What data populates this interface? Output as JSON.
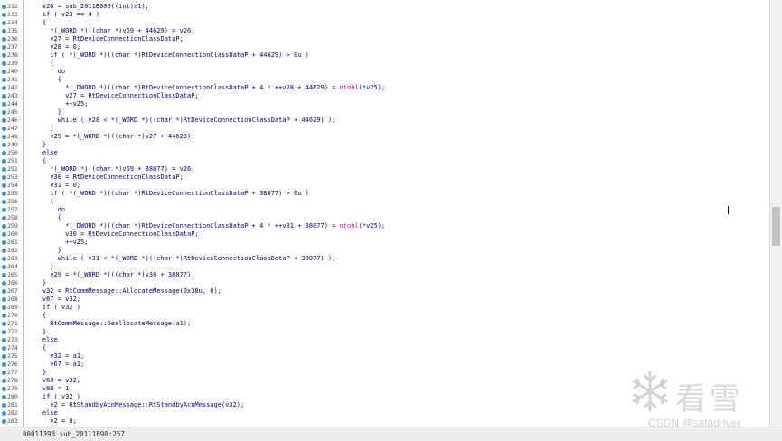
{
  "lines": [
    {
      "num": "232",
      "code": "    v26 = sub_2011E000((int)a1);"
    },
    {
      "num": "233",
      "code": "    if ( v23 == 4 )"
    },
    {
      "num": "234",
      "code": "    {"
    },
    {
      "num": "235",
      "code": "      *(_WORD *)((char *)v69 + 44629) = v26;"
    },
    {
      "num": "236",
      "code": "      v27 = RtDeviceConnectionClassDataP;"
    },
    {
      "num": "237",
      "code": "      v28 = 0;"
    },
    {
      "num": "238",
      "code": "      if ( *(_WORD *)((char *)RtDeviceConnectionClassDataP + 44629) > 0u )"
    },
    {
      "num": "239",
      "code": "      {"
    },
    {
      "num": "240",
      "code": "        do"
    },
    {
      "num": "241",
      "code": "        {"
    },
    {
      "num": "242",
      "code": "          *(_DWORD *)((char *)RtDeviceConnectionClassDataP + 4 * ++v28 + 44629) = ntohl(*v25);"
    },
    {
      "num": "243",
      "code": "          v27 = RtDeviceConnectionClassDataP;"
    },
    {
      "num": "244",
      "code": "          ++v25;"
    },
    {
      "num": "245",
      "code": "        }"
    },
    {
      "num": "246",
      "code": "        while ( v28 < *(_WORD *)((char *)RtDeviceConnectionClassDataP + 44629) );"
    },
    {
      "num": "247",
      "code": "      }"
    },
    {
      "num": "248",
      "code": "      v29 = *(_WORD *)((char *)v27 + 44629);"
    },
    {
      "num": "249",
      "code": "    }"
    },
    {
      "num": "250",
      "code": "    else"
    },
    {
      "num": "251",
      "code": "    {"
    },
    {
      "num": "252",
      "code": "      *(_WORD *)((char *)v69 + 38077) = v26;"
    },
    {
      "num": "253",
      "code": "      v30 = RtDeviceConnectionClassDataP;"
    },
    {
      "num": "254",
      "code": "      v31 = 0;"
    },
    {
      "num": "255",
      "code": "      if ( *(_WORD *)((char *)RtDeviceConnectionClassDataP + 38077) > 0u )"
    },
    {
      "num": "256",
      "code": "      {"
    },
    {
      "num": "257",
      "code": "        do"
    },
    {
      "num": "258",
      "code": "        {"
    },
    {
      "num": "259",
      "code": "          *(_DWORD *)((char *)RtDeviceConnectionClassDataP + 4 * ++v31 + 38077) = ntohl(*v25);"
    },
    {
      "num": "260",
      "code": "          v30 = RtDeviceConnectionClassDataP;"
    },
    {
      "num": "261",
      "code": "          ++v25;"
    },
    {
      "num": "262",
      "code": "        }"
    },
    {
      "num": "263",
      "code": "        while ( v31 < *(_WORD *)((char *)RtDeviceConnectionClassDataP + 38077) );"
    },
    {
      "num": "264",
      "code": "      }"
    },
    {
      "num": "265",
      "code": "      v29 = *(_WORD *)((char *)v30 + 38077);"
    },
    {
      "num": "266",
      "code": "    }"
    },
    {
      "num": "267",
      "code": "    v32 = RtCommMessage::AllocateMessage(0x38u, 0);"
    },
    {
      "num": "268",
      "code": "    v67 = v32;"
    },
    {
      "num": "269",
      "code": "    if ( v32 )"
    },
    {
      "num": "270",
      "code": "    {"
    },
    {
      "num": "271",
      "code": "      RtCommMessage::DeallocateMessage(a1);"
    },
    {
      "num": "272",
      "code": "    }"
    },
    {
      "num": "273",
      "code": "    else"
    },
    {
      "num": "274",
      "code": "    {"
    },
    {
      "num": "275",
      "code": "      v32 = a1;"
    },
    {
      "num": "276",
      "code": "      v67 = a1;"
    },
    {
      "num": "277",
      "code": "    }"
    },
    {
      "num": "278",
      "code": "    v68 = v32;"
    },
    {
      "num": "279",
      "code": "    v80 = 1;"
    },
    {
      "num": "280",
      "code": "    if ( v32 )"
    },
    {
      "num": "281",
      "code": "      v2 = RtStandbyAcnMessage::RtStandbyAcnMessage(v32);"
    },
    {
      "num": "282",
      "code": "    else"
    },
    {
      "num": "283",
      "code": "      v2 = 0;"
    }
  ],
  "status": {
    "text": "00011398 sub_20111B90:257"
  },
  "watermark": {
    "brand": "看雪",
    "csdn": "CSDN @satadriver"
  },
  "colors": {
    "dot": "#3b8fd9",
    "code": "#000080",
    "call": "#d000a0"
  }
}
